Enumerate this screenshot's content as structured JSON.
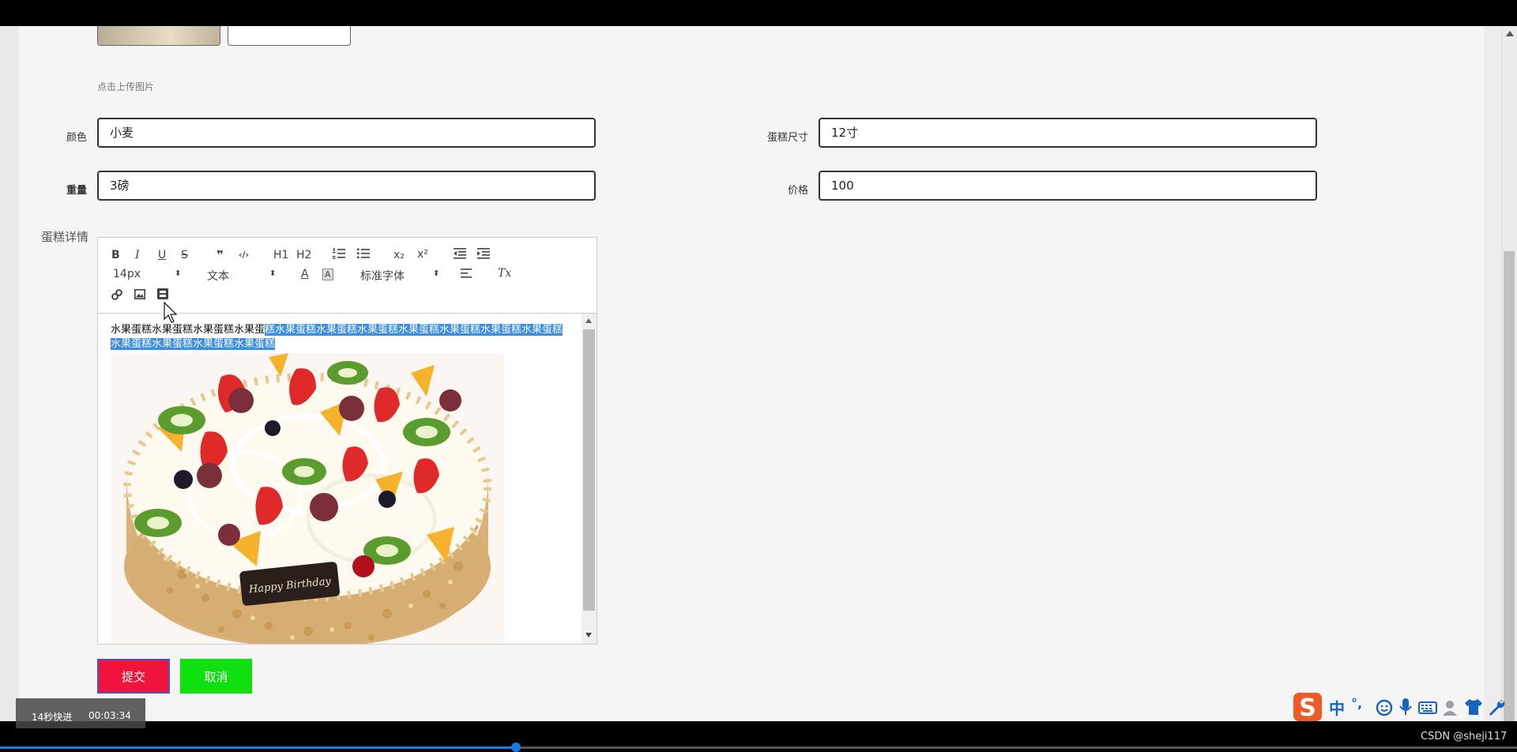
{
  "upload": {
    "hint": "点击上传图片"
  },
  "fields": {
    "color": {
      "label": "颜色",
      "value": "小麦"
    },
    "size": {
      "label": "蛋糕尺寸",
      "value": "12寸"
    },
    "weight": {
      "label": "重量",
      "value": "3磅"
    },
    "price": {
      "label": "价格",
      "value": "100"
    }
  },
  "detail": {
    "label": "蛋糕详情",
    "toolbar": {
      "bold": "B",
      "italic": "I",
      "underline": "U",
      "strike": "S",
      "quote": "❞",
      "code": "‹/›",
      "h1": "H1",
      "h2": "H2",
      "subscript": "x₂",
      "superscript": "x²",
      "font_size": "14px",
      "block_type": "文本",
      "font_family": "标准字体",
      "clear_format": "Tx"
    },
    "text_plain": "水果蛋糕水果蛋糕水果蛋糕水果蛋",
    "text_selected": "糕水果蛋糕水果蛋糕水果蛋糕水果蛋糕水果蛋糕水果蛋糕水果蛋糕水果蛋糕水果蛋糕水果蛋糕水果蛋糕",
    "image_caption": "Happy Birthday"
  },
  "buttons": {
    "submit": "提交",
    "cancel": "取消"
  },
  "video": {
    "skip": "14秒快进",
    "time": "00:03:34",
    "progress_fraction": 0.34
  },
  "watermark": "CSDN @sheji117",
  "ime": {
    "lang": "中",
    "punct": "°,"
  },
  "colors": {
    "submit": "#f0143c",
    "cancel": "#10e010",
    "selection": "#3b8ee8"
  }
}
